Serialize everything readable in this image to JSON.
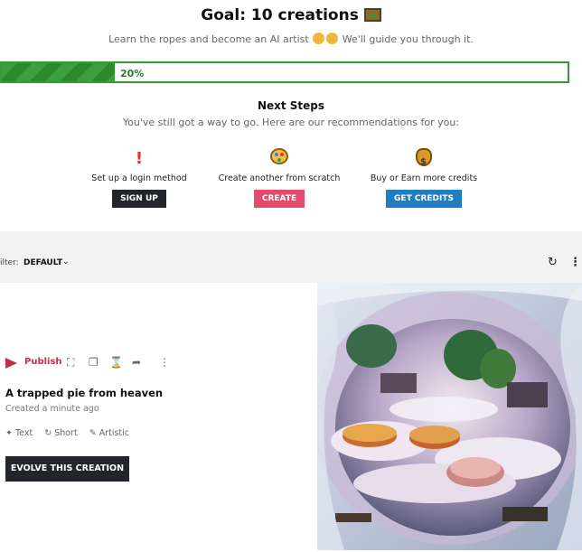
{
  "goal": {
    "title": "Goal: 10 creations",
    "subtitle_before": "Learn the ropes and become an AI artist",
    "subtitle_after": "We'll guide you through it.",
    "progress_percent": 20,
    "progress_label": "20%"
  },
  "next_steps": {
    "title": "Next Steps",
    "subtitle": "You've still got a way to go. Here are our recommendations for you:",
    "items": [
      {
        "icon": "exclamation-icon",
        "label": "Set up a login method",
        "button": "SIGN UP",
        "color": "#22262a"
      },
      {
        "icon": "palette-icon",
        "label": "Create another from scratch",
        "button": "CREATE",
        "color": "#e14b6e"
      },
      {
        "icon": "money-bag-icon",
        "label": "Buy or Earn more credits",
        "button": "GET CREDITS",
        "color": "#1f7ec0"
      }
    ]
  },
  "filter": {
    "label": "ilter:",
    "value": "DEFAULT"
  },
  "creation": {
    "publish_label": "Publish",
    "title": "A trapped pie from heaven",
    "created": "Created a minute ago",
    "tags": [
      {
        "icon": "magic-wand-icon",
        "label": "Text"
      },
      {
        "icon": "refresh-icon",
        "label": "Short"
      },
      {
        "icon": "palette-icon",
        "label": "Artistic"
      }
    ],
    "evolve_label": "EVOLVE THIS CREATION"
  },
  "colors": {
    "progress_green": "#3a9a3a",
    "publish_red": "#c0304a"
  }
}
